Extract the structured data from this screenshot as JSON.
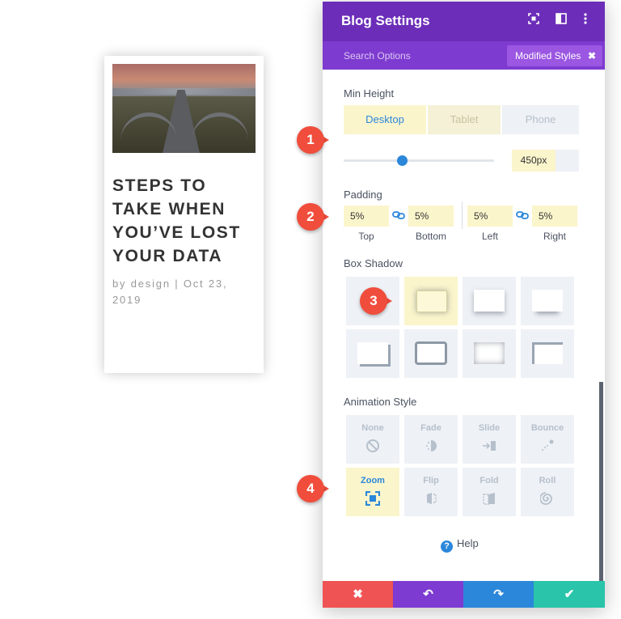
{
  "blog_card": {
    "title": "STEPS TO TAKE WHEN YOU’VE LOST YOUR DATA",
    "meta": "by design | Oct 23, 2019"
  },
  "panel": {
    "title": "Blog Settings",
    "header_icons": [
      "expand-icon",
      "split-view-icon",
      "more-icon"
    ],
    "search_placeholder": "Search Options",
    "modified_styles_label": "Modified Styles",
    "modified_styles_close": "✖"
  },
  "min_height": {
    "label": "Min Height",
    "tabs": [
      "Desktop",
      "Tablet",
      "Phone"
    ],
    "active_tab": "Desktop",
    "value": "450px",
    "slider_level": 0.4
  },
  "padding": {
    "label": "Padding",
    "fields": [
      {
        "caption": "Top",
        "value": "5%"
      },
      {
        "caption": "Bottom",
        "value": "5%"
      },
      {
        "caption": "Left",
        "value": "5%"
      },
      {
        "caption": "Right",
        "value": "5%"
      }
    ]
  },
  "box_shadow": {
    "label": "Box Shadow",
    "selected_index": 1,
    "preset_count": 8
  },
  "animation_style": {
    "label": "Animation Style",
    "options": [
      "None",
      "Fade",
      "Slide",
      "Bounce",
      "Zoom",
      "Flip",
      "Fold",
      "Roll"
    ],
    "selected": "Zoom"
  },
  "help_label": "Help",
  "footer": {
    "cancel_icon": "✖",
    "undo_icon": "↶",
    "redo_icon": "↷",
    "save_icon": "✔"
  },
  "callouts": [
    "1",
    "2",
    "3",
    "4"
  ],
  "colors": {
    "header": "#6c2eb9",
    "subbar": "#7e3bd0",
    "highlight": "#fbf5cc",
    "accent_blue": "#2b87da",
    "cancel": "#ef5354",
    "undo": "#7d3bd1",
    "redo": "#2b87da",
    "save": "#29c4a9",
    "callout": "#f04d3c"
  }
}
